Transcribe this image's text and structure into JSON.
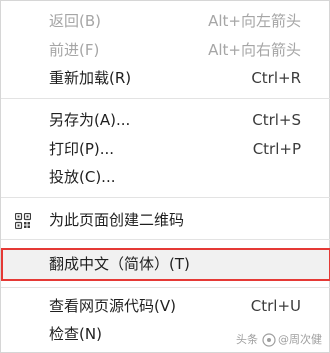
{
  "menu": {
    "items": [
      {
        "label": "返回(B)",
        "shortcut": "Alt+向左箭头",
        "enabled": false
      },
      {
        "label": "前进(F)",
        "shortcut": "Alt+向右箭头",
        "enabled": false
      },
      {
        "label": "重新加载(R)",
        "shortcut": "Ctrl+R",
        "enabled": true
      },
      {
        "label": "另存为(A)...",
        "shortcut": "Ctrl+S",
        "enabled": true
      },
      {
        "label": "打印(P)...",
        "shortcut": "Ctrl+P",
        "enabled": true
      },
      {
        "label": "投放(C)...",
        "shortcut": "",
        "enabled": true
      },
      {
        "label": "为此页面创建二维码",
        "shortcut": "",
        "enabled": true,
        "icon": "qr-code-icon"
      },
      {
        "label": "翻成中文（简体）(T)",
        "shortcut": "",
        "enabled": true,
        "highlighted": true
      },
      {
        "label": "查看网页源代码(V)",
        "shortcut": "Ctrl+U",
        "enabled": true
      },
      {
        "label": "检查(N)",
        "shortcut": "",
        "enabled": true
      }
    ]
  },
  "colors": {
    "highlight_border": "#e53935",
    "disabled_text": "#a6a6a6"
  },
  "watermark": {
    "platform": "头条",
    "author": "@周次健"
  }
}
